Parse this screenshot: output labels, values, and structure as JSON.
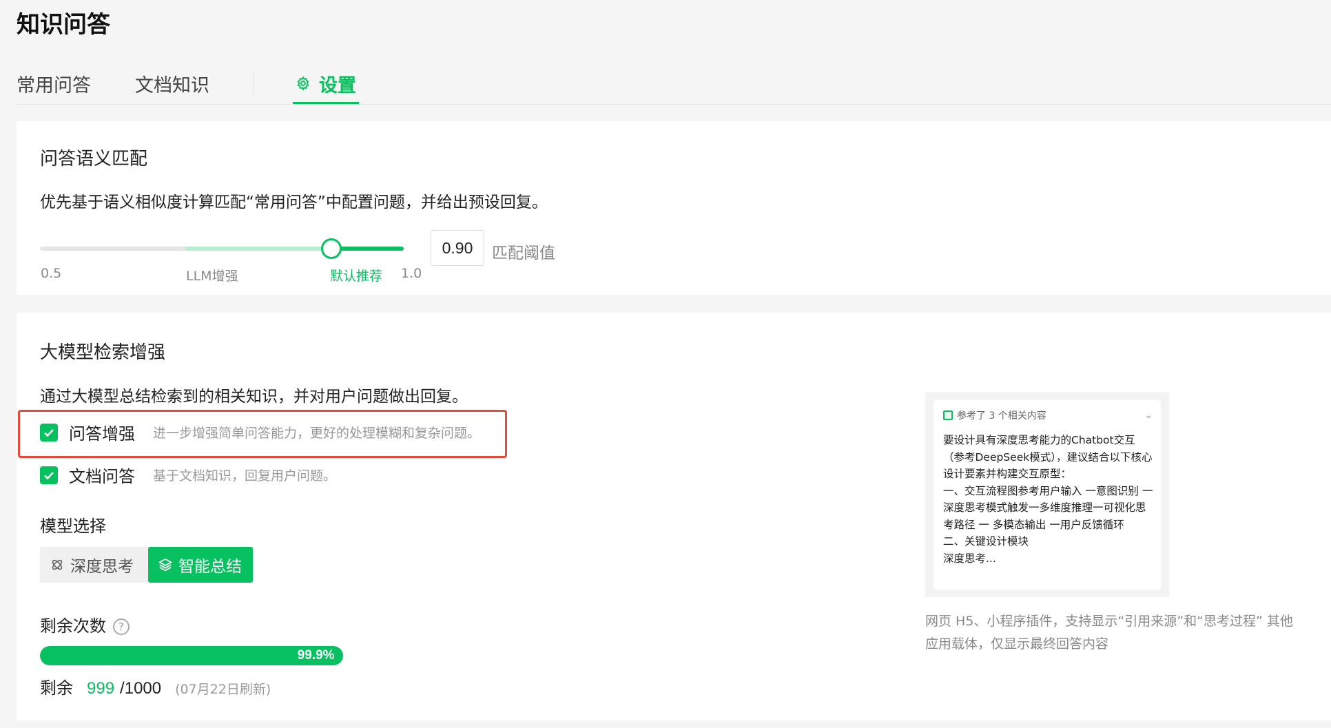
{
  "page": {
    "title": "知识问答"
  },
  "tabs": [
    {
      "label": "常用问答"
    },
    {
      "label": "文档知识"
    },
    {
      "label": "设置",
      "icon": "gear-icon",
      "active": true
    }
  ],
  "semantic_match": {
    "title": "问答语义匹配",
    "desc": "优先基于语义相似度计算匹配“常用问答”中配置问题，并给出预设回复。",
    "slider": {
      "value": 0.9,
      "min_label": "0.5",
      "mid_label": "LLM增强",
      "recommend_label": "默认推荐",
      "max_label": "1.0"
    },
    "threshold_value": "0.90",
    "threshold_label": "匹配阈值"
  },
  "llm_enhance": {
    "title": "大模型检索增强",
    "desc": "通过大模型总结检索到的相关知识，并对用户问题做出回复。",
    "options": [
      {
        "label": "问答增强",
        "desc": "进一步增强简单问答能力，更好的处理模糊和复杂问题。",
        "checked": true
      },
      {
        "label": "文档问答",
        "desc": "基于文档知识，回复用户问题。",
        "checked": true
      }
    ],
    "model_select_label": "模型选择",
    "models": [
      {
        "label": "深度思考",
        "icon": "deep-think-icon",
        "active": false
      },
      {
        "label": "智能总结",
        "icon": "layers-icon",
        "active": true
      }
    ],
    "remaining_label": "剩余次数",
    "progress_fraction": 0.999,
    "progress_text": "99.9%",
    "remain_prefix": "剩余",
    "remain_count": "999",
    "remain_total": "/1000",
    "refresh_note": "(07月22日刷新)"
  },
  "preview": {
    "ref_text": "参考了 3 个相关内容",
    "body": "要设计具有深度思考能力的Chatbot交互（参考DeepSeek模式），建议结合以下核心设计要素并构建交互原型：\n一、交互流程图参考用户输入 一意图识别 一深度思考模式触发一多维度推理一可视化思考路径 一 多模态输出 一用户反馈循环\n二、关键设计模块\n深度思考...",
    "note": "网页 H5、小程序插件，支持显示“引用来源”和“思考过程” 其他应用载体，仅显示最终回答内容"
  },
  "colors": {
    "accent": "#07c160",
    "highlight": "#e34b3b"
  }
}
